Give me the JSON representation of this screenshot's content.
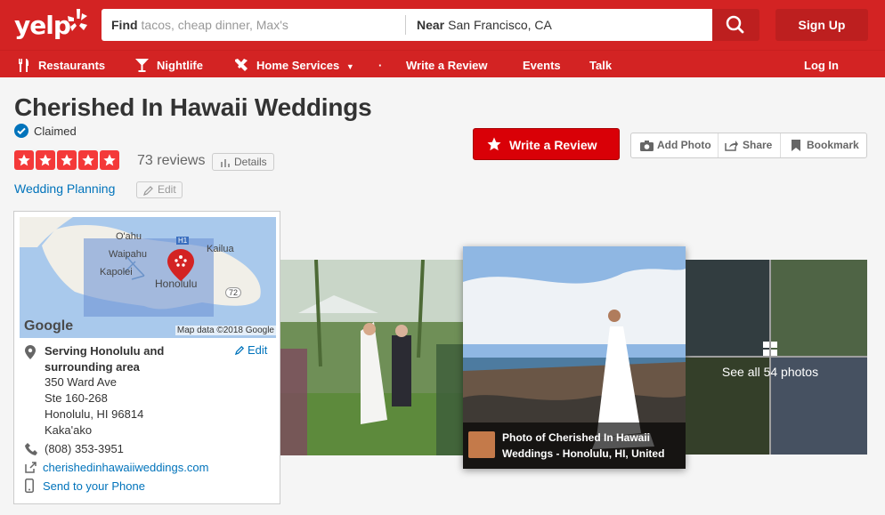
{
  "header": {
    "logo_text": "yelp",
    "find_label": "Find",
    "find_placeholder": "tacos, cheap dinner, Max's",
    "near_label": "Near",
    "near_value": "San Francisco, CA",
    "signup_label": "Sign Up"
  },
  "nav": {
    "restaurants": "Restaurants",
    "nightlife": "Nightlife",
    "home_services": "Home Services",
    "dot": "·",
    "write_review": "Write a Review",
    "events": "Events",
    "talk": "Talk",
    "login": "Log In"
  },
  "business": {
    "name": "Cherished In Hawaii Weddings",
    "claimed": "Claimed",
    "rating_stars": 5,
    "reviews": "73 reviews",
    "details_label": "Details",
    "category": "Wedding Planning",
    "edit_label": "Edit"
  },
  "actions": {
    "write_review": "Write a Review",
    "add_photo": "Add Photo",
    "share": "Share",
    "bookmark": "Bookmark"
  },
  "map": {
    "labels": {
      "oahu": "O'ahu",
      "waipahu": "Waipahu",
      "kapolei": "Kapolei",
      "kailua": "Kailua",
      "honolulu": "Honolulu",
      "route": "72",
      "interstate": "H1"
    },
    "google": "Google",
    "credit": "Map data ©2018 Google"
  },
  "location": {
    "serving": "Serving Honolulu and surrounding area",
    "edit_label": "Edit",
    "address_line1": "350 Ward Ave",
    "address_line2": "Ste 160-268",
    "address_line3": "Honolulu, HI 96814",
    "neighborhood": "Kaka'ako",
    "phone": "(808) 353-3951",
    "website": "cherishedinhawaiiweddings.com",
    "send_phone": "Send to your Phone"
  },
  "photos": {
    "caption_line1": "Photo of Cherished In Hawaii",
    "caption_line2": "Weddings - Honolulu, HI, United",
    "see_all": "See all 54 photos"
  },
  "colors": {
    "brand_red": "#d32323",
    "button_red": "#d90007",
    "link_blue": "#0073bb",
    "star_red": "#f43939"
  }
}
